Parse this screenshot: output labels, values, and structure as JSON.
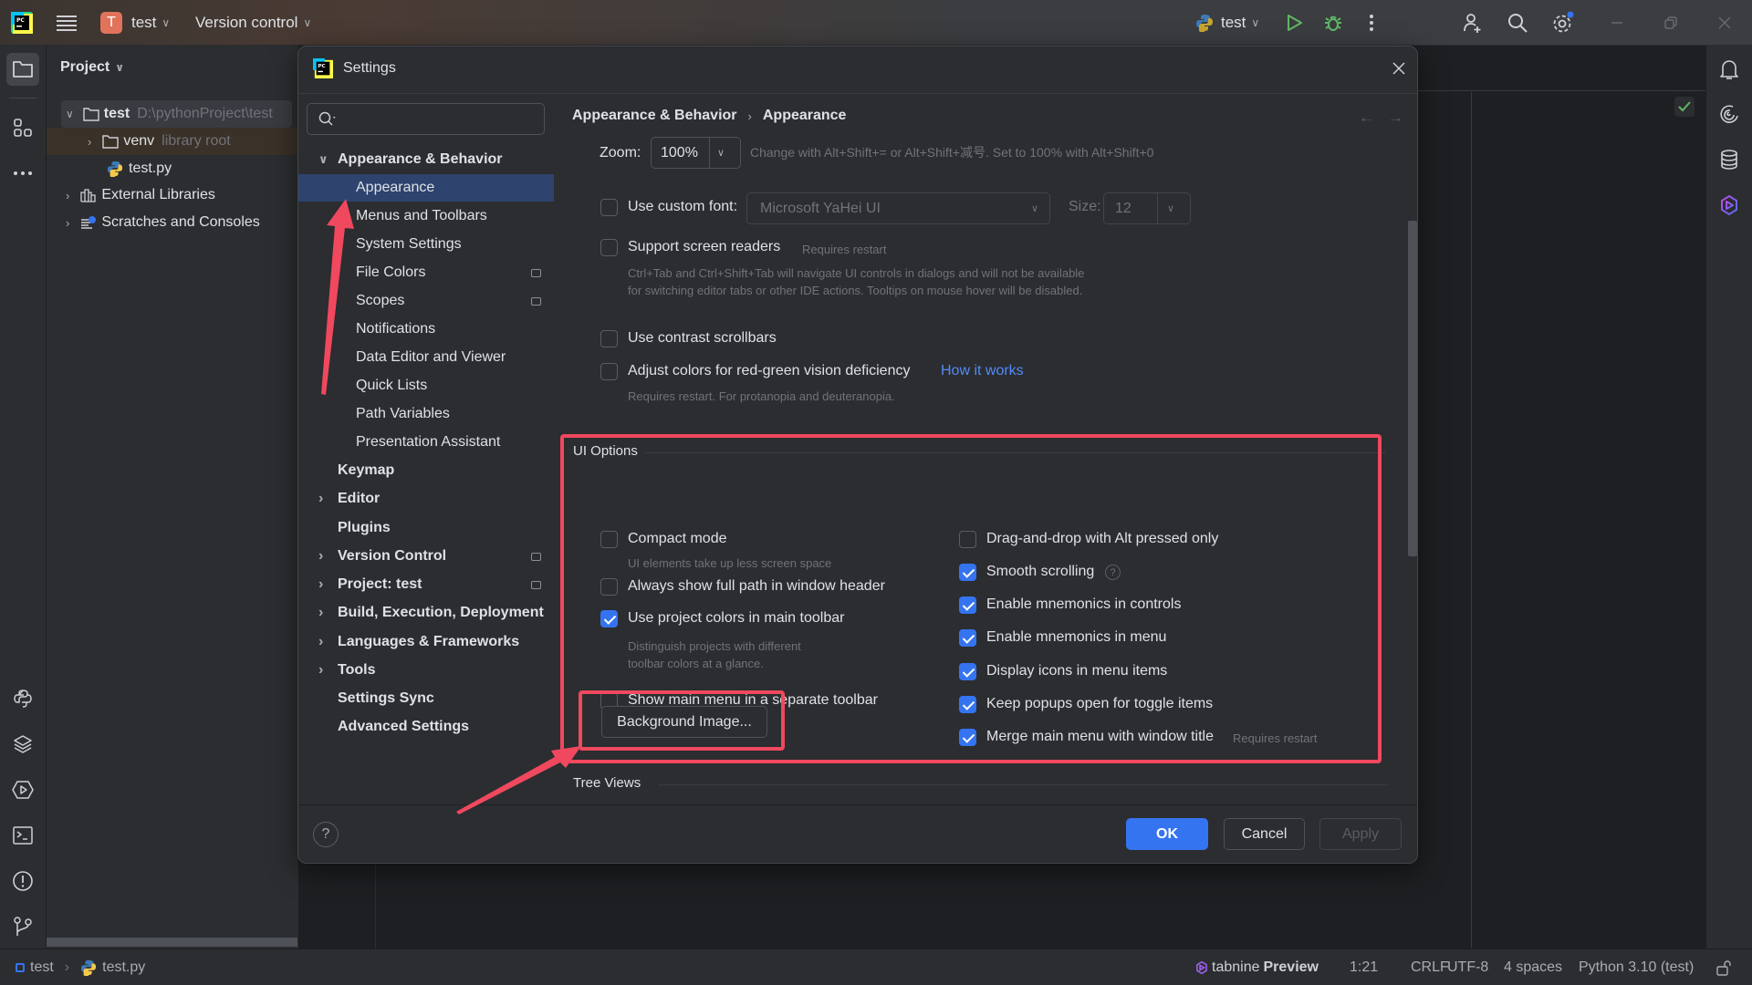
{
  "titlebar": {
    "project_initial": "T",
    "project_name": "test",
    "vcs_label": "Version control",
    "run_config": "test",
    "colors": {
      "project_badge": "#e0735a",
      "run": "#5fb865",
      "notification_dot": "#3574f0"
    }
  },
  "project_panel": {
    "title": "Project",
    "tree": [
      {
        "label": "test",
        "detail": "D:\\pythonProject\\test",
        "icon": "folder-icon",
        "expanded": true
      },
      {
        "label": "venv",
        "detail": "library root",
        "icon": "folder-icon",
        "expanded": false
      },
      {
        "label": "test.py",
        "detail": "",
        "icon": "python-file-icon"
      },
      {
        "label": "External Libraries",
        "detail": "",
        "icon": "library-icon",
        "expanded": false
      },
      {
        "label": "Scratches and Consoles",
        "detail": "",
        "icon": "scratches-icon",
        "expanded": false
      }
    ]
  },
  "dialog": {
    "title": "Settings",
    "search_placeholder": "",
    "nav": [
      {
        "label": "Appearance & Behavior",
        "bold": true,
        "arrow": "expanded"
      },
      {
        "label": "Appearance",
        "selected": true
      },
      {
        "label": "Menus and Toolbars"
      },
      {
        "label": "System Settings"
      },
      {
        "label": "File Colors",
        "badge": true
      },
      {
        "label": "Scopes",
        "badge": true
      },
      {
        "label": "Notifications"
      },
      {
        "label": "Data Editor and Viewer"
      },
      {
        "label": "Quick Lists"
      },
      {
        "label": "Path Variables"
      },
      {
        "label": "Presentation Assistant"
      },
      {
        "label": "Keymap",
        "bold": true
      },
      {
        "label": "Editor",
        "bold": true,
        "arrow": "collapsed"
      },
      {
        "label": "Plugins",
        "bold": true
      },
      {
        "label": "Version Control",
        "bold": true,
        "arrow": "collapsed",
        "badge": true
      },
      {
        "label": "Project: test",
        "bold": true,
        "arrow": "collapsed",
        "badge": true
      },
      {
        "label": "Build, Execution, Deployment",
        "bold": true,
        "arrow": "collapsed"
      },
      {
        "label": "Languages & Frameworks",
        "bold": true,
        "arrow": "collapsed"
      },
      {
        "label": "Tools",
        "bold": true,
        "arrow": "collapsed"
      },
      {
        "label": "Settings Sync",
        "bold": true
      },
      {
        "label": "Advanced Settings",
        "bold": true
      }
    ],
    "breadcrumb": [
      "Appearance & Behavior",
      "Appearance"
    ],
    "zoom": {
      "label": "Zoom:",
      "value": "100%",
      "hint": "Change with Alt+Shift+= or Alt+Shift+减号. Set to 100% with Alt+Shift+0"
    },
    "custom_font": {
      "label": "Use custom font:",
      "checked": false,
      "font_value": "Microsoft YaHei UI",
      "size_label": "Size:",
      "size_value": "12"
    },
    "screen_readers": {
      "label": "Support screen readers",
      "checked": false,
      "note": "Requires restart",
      "hint": "Ctrl+Tab and Ctrl+Shift+Tab will navigate UI controls in dialogs and will not be available for switching editor tabs or other IDE actions. Tooltips on mouse hover will be disabled."
    },
    "contrast_scrollbars": {
      "label": "Use contrast scrollbars",
      "checked": false
    },
    "color_deficiency": {
      "label": "Adjust colors for red-green vision deficiency",
      "checked": false,
      "link": "How it works",
      "hint": "Requires restart. For protanopia and deuteranopia."
    },
    "ui_options": {
      "title": "UI Options",
      "left": [
        {
          "label": "Compact mode",
          "checked": false,
          "hint": "UI elements take up less screen space"
        },
        {
          "label": "Always show full path in window header",
          "checked": false
        },
        {
          "label": "Use project colors in main toolbar",
          "checked": true,
          "hint": "Distinguish projects with different toolbar colors at a glance."
        },
        {
          "label": "Show main menu in a separate toolbar",
          "checked": false
        }
      ],
      "right": [
        {
          "label": "Drag-and-drop with Alt pressed only",
          "checked": false
        },
        {
          "label": "Smooth scrolling",
          "checked": true,
          "help": true
        },
        {
          "label": "Enable mnemonics in controls",
          "checked": true
        },
        {
          "label": "Enable mnemonics in menu",
          "checked": true
        },
        {
          "label": "Display icons in menu items",
          "checked": true
        },
        {
          "label": "Keep popups open for toggle items",
          "checked": true
        },
        {
          "label": "Merge main menu with window title",
          "checked": true,
          "note": "Requires restart"
        }
      ],
      "background_button": "Background Image..."
    },
    "tree_views_title": "Tree Views",
    "footer": {
      "ok": "OK",
      "cancel": "Cancel",
      "apply": "Apply"
    },
    "colors": {
      "accent": "#3574f0",
      "selection": "#2e436e",
      "annotation": "#f0485e",
      "link": "#548af7"
    }
  },
  "statusbar": {
    "breadcrumb": [
      "test",
      "test.py"
    ],
    "tabnine": "tabnine",
    "tabnine_bold": "Preview",
    "position": "1:21",
    "line_sep": "CRLF",
    "encoding": "UTF-8",
    "indent": "4 spaces",
    "interpreter": "Python 3.10 (test)"
  }
}
